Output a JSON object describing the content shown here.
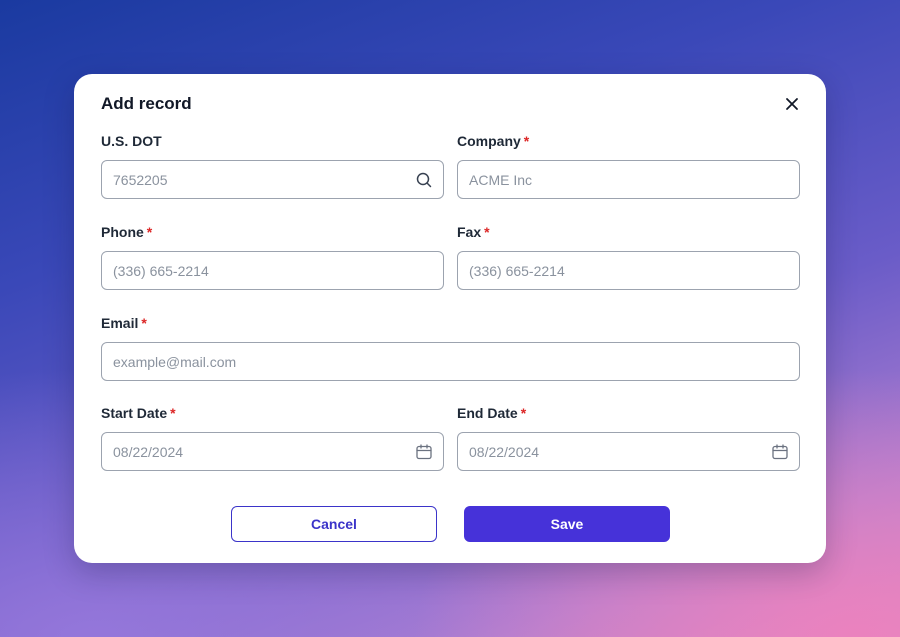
{
  "modal": {
    "title": "Add record",
    "close_icon": "close-icon"
  },
  "fields": {
    "dot": {
      "label": "U.S. DOT",
      "required": false,
      "placeholder": "7652205",
      "icon": "search-icon"
    },
    "company": {
      "label": "Company",
      "required": true,
      "placeholder": "ACME Inc"
    },
    "phone": {
      "label": "Phone",
      "required": true,
      "placeholder": "(336) 665-2214"
    },
    "fax": {
      "label": "Fax",
      "required": true,
      "placeholder": "(336) 665-2214"
    },
    "email": {
      "label": "Email",
      "required": true,
      "placeholder": "example@mail.com"
    },
    "start_date": {
      "label": "Start Date",
      "required": true,
      "placeholder": "08/22/2024",
      "icon": "calendar-icon"
    },
    "end_date": {
      "label": "End Date",
      "required": true,
      "placeholder": "08/22/2024",
      "icon": "calendar-icon"
    }
  },
  "required_mark": "*",
  "buttons": {
    "cancel": "Cancel",
    "save": "Save"
  },
  "colors": {
    "primary": "#4632d9",
    "required": "#dc2626"
  }
}
